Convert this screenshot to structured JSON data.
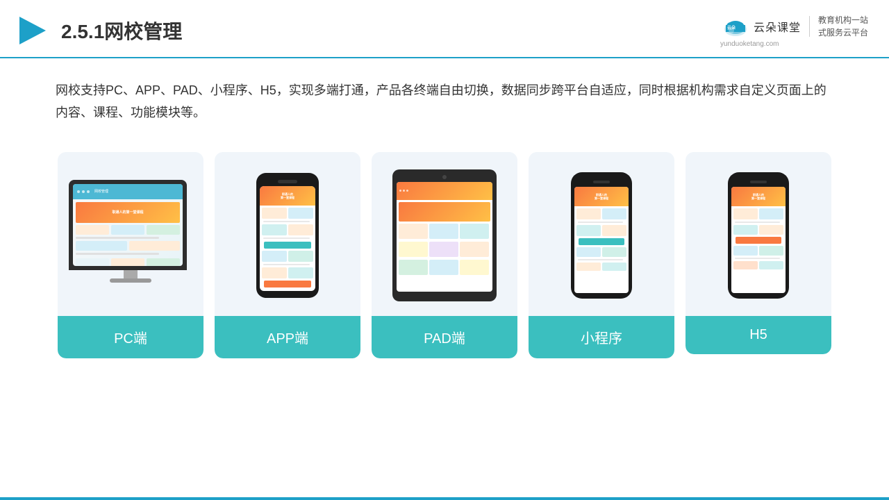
{
  "header": {
    "title": "2.5.1网校管理",
    "logo": {
      "name": "云朵课堂",
      "url": "yunduoketang.com",
      "tagline_line1": "教育机构一站",
      "tagline_line2": "式服务云平台"
    }
  },
  "description": "网校支持PC、APP、PAD、小程序、H5，实现多端打通，产品各终端自由切换，数据同步跨平台自适应，同时根据机构需求自定义页面上的内容、课程、功能模块等。",
  "cards": [
    {
      "id": "pc",
      "label": "PC端"
    },
    {
      "id": "app",
      "label": "APP端"
    },
    {
      "id": "pad",
      "label": "PAD端"
    },
    {
      "id": "miniprogram",
      "label": "小程序"
    },
    {
      "id": "h5",
      "label": "H5"
    }
  ],
  "colors": {
    "accent": "#1da0c8",
    "card_label_bg": "#3bbfbf",
    "card_label_text": "#ffffff",
    "title_color": "#333333",
    "desc_color": "#333333",
    "card_bg": "#f0f5fa"
  }
}
